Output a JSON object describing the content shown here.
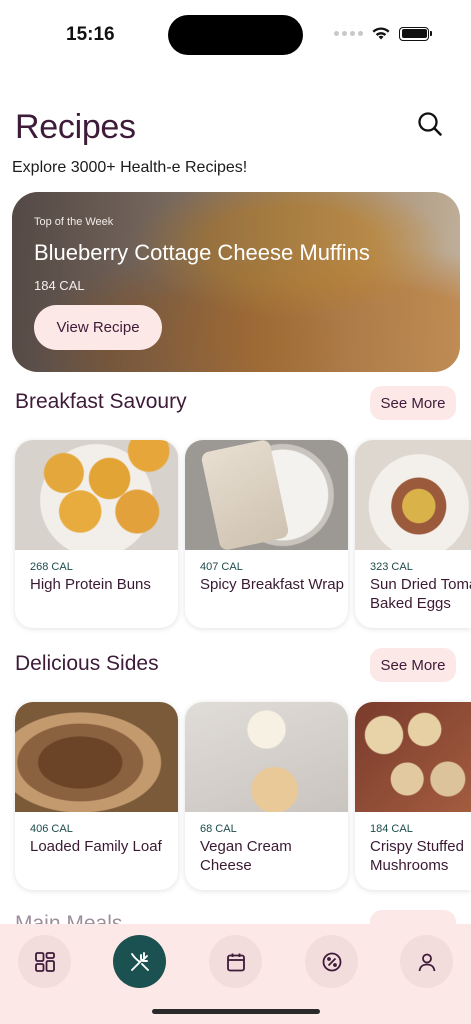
{
  "status_bar": {
    "time": "15:16"
  },
  "header": {
    "title": "Recipes",
    "subtitle": "Explore 3000+ Health-e Recipes!"
  },
  "hero": {
    "label": "Top of the Week",
    "title": "Blueberry Cottage Cheese Muffins",
    "calories": "184 CAL",
    "button": "View Recipe"
  },
  "sections": [
    {
      "title": "Breakfast Savoury",
      "see_more": "See More",
      "cards": [
        {
          "calories": "268 CAL",
          "name": "High Protein Buns"
        },
        {
          "calories": "407 CAL",
          "name": "Spicy Breakfast Wrap"
        },
        {
          "calories": "323 CAL",
          "name": "Sun Dried Tomato Baked Eggs"
        }
      ]
    },
    {
      "title": "Delicious Sides",
      "see_more": "See More",
      "cards": [
        {
          "calories": "406 CAL",
          "name": "Loaded Family Loaf"
        },
        {
          "calories": "68 CAL",
          "name": "Vegan Cream Cheese"
        },
        {
          "calories": "184 CAL",
          "name": "Crispy Stuffed Mushrooms"
        }
      ]
    },
    {
      "title": "Main Meals"
    }
  ],
  "tabbar": {
    "icons": [
      "dashboard-icon",
      "recipes-icon",
      "calendar-icon",
      "discount-icon",
      "profile-icon"
    ],
    "active_index": 1
  },
  "colors": {
    "primary_text": "#3e1b38",
    "accent_pink": "#fde8e8",
    "accent_teal": "#1b5150"
  }
}
